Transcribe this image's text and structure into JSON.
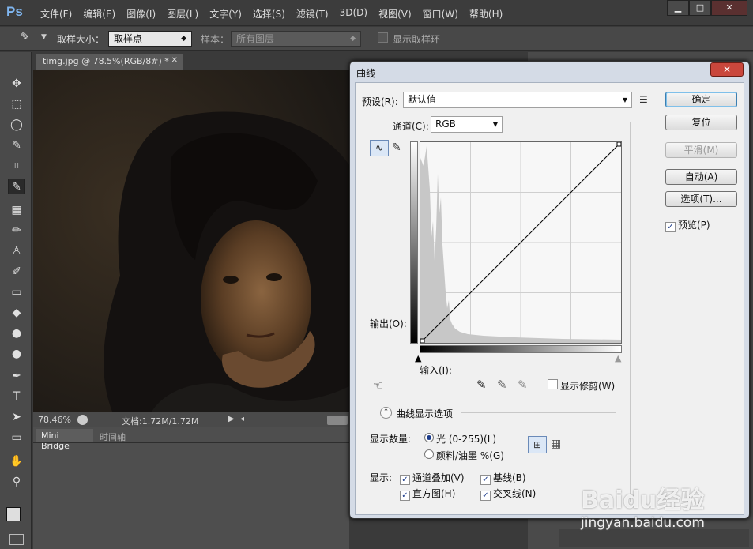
{
  "app": {
    "logo": "Ps"
  },
  "menu": [
    "文件(F)",
    "编辑(E)",
    "图像(I)",
    "图层(L)",
    "文字(Y)",
    "选择(S)",
    "滤镜(T)",
    "3D(D)",
    "视图(V)",
    "窗口(W)",
    "帮助(H)"
  ],
  "window_buttons": [
    "▁",
    "□",
    "✕"
  ],
  "options": {
    "sample_size_label": "取样大小：",
    "sample_size_value": "取样点",
    "sample_label": "样本：",
    "sample_value": "所有图层",
    "show_ring": "显示取样环"
  },
  "document": {
    "tab": "timg.jpg @ 78.5%(RGB/8#) *",
    "zoom": "78.46%",
    "doc_info": "文档:1.72M/1.72M"
  },
  "bottom_tabs": [
    "Mini Bridge",
    "时间轴"
  ],
  "dialog": {
    "title": "曲线",
    "preset_label": "预设(R):",
    "preset_value": "默认值",
    "channel_label": "通道(C):",
    "channel_value": "RGB",
    "output_label": "输出(O):",
    "input_label": "输入(I):",
    "show_clipping": "显示修剪(W)",
    "curve_options": "曲线显示选项",
    "amount_label": "显示数量:",
    "light": "光 (0-255)(L)",
    "pigment": "颜料/油墨 %(G)",
    "show_label": "显示:",
    "channel_overlays": "通道叠加(V)",
    "baseline": "基线(B)",
    "histogram": "直方图(H)",
    "intersection": "交叉线(N)",
    "buttons": {
      "ok": "确定",
      "reset": "复位",
      "smooth": "平滑(M)",
      "auto": "自动(A)",
      "options": "选项(T)...",
      "preview": "预览(P)"
    }
  },
  "watermark": {
    "line1": "Baidu经验",
    "line2": "jingyan.baidu.com"
  }
}
